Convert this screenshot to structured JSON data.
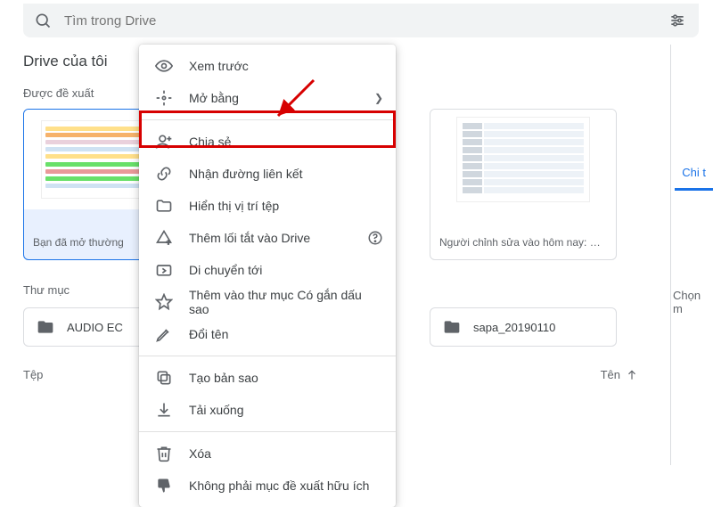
{
  "search": {
    "placeholder": "Tìm trong Drive"
  },
  "page_title": "Drive của tôi",
  "suggest_label": "Được đề xuất",
  "cards": [
    {
      "caption": "Bạn đã mở thường"
    },
    {
      "caption": "Người chỉnh sửa vào hôm nay: Vo..."
    }
  ],
  "folders_label": "Thư mục",
  "sort": {
    "label": "Tên"
  },
  "folders": [
    {
      "name": "AUDIO EC"
    },
    {
      "name": "sapa_20190110"
    }
  ],
  "files_label": "Tệp",
  "right": {
    "tab": "Chi t",
    "hint": "Chọn m"
  },
  "ctx": {
    "preview": "Xem trước",
    "open_with": "Mở bằng",
    "share": "Chia sẻ",
    "get_link": "Nhận đường liên kết",
    "show_location": "Hiển thị vị trí tệp",
    "add_shortcut": "Thêm lối tắt vào Drive",
    "move_to": "Di chuyển tới",
    "star": "Thêm vào thư mục Có gắn dấu sao",
    "rename": "Đổi tên",
    "copy": "Tạo bản sao",
    "download": "Tải xuống",
    "remove": "Xóa",
    "not_helpful": "Không phải mục đề xuất hữu ích"
  }
}
